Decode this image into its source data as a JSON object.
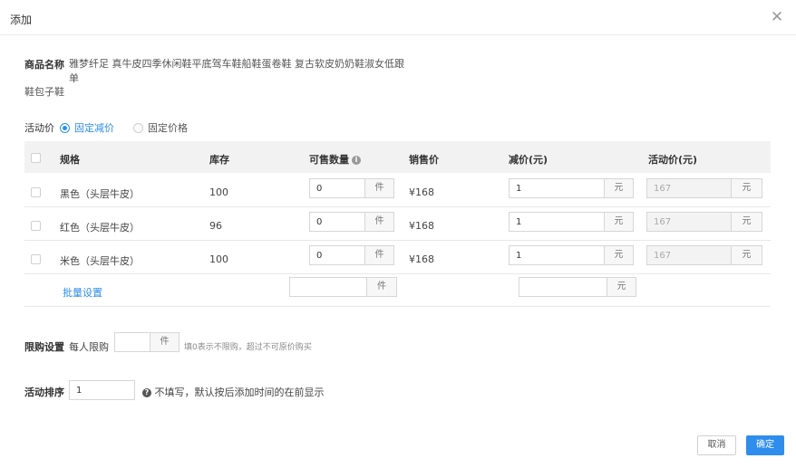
{
  "dialog": {
    "title": "添加",
    "close_glyph": "✕"
  },
  "product": {
    "label": "商品名称",
    "name_line1": "雅梦纤足 真牛皮四季休闲鞋平底驾车鞋船鞋蛋卷鞋 复古软皮奶奶鞋淑女低跟单",
    "name_line2": "鞋包子鞋"
  },
  "activity_price": {
    "label": "活动价",
    "options": [
      "固定减价",
      "固定价格"
    ],
    "selected": "固定减价"
  },
  "table": {
    "headers": {
      "spec": "规格",
      "stock": "库存",
      "sellable": "可售数量",
      "price": "销售价",
      "discount": "减价(元)",
      "activity": "活动价(元)"
    },
    "rows": [
      {
        "spec": "黑色（头层牛皮）",
        "stock": "100",
        "qty": "0",
        "qty_unit": "件",
        "price": "¥168",
        "discount": "1",
        "discount_unit": "元",
        "activity_price": "167",
        "activity_unit": "元"
      },
      {
        "spec": "红色（头层牛皮）",
        "stock": "96",
        "qty": "0",
        "qty_unit": "件",
        "price": "¥168",
        "discount": "1",
        "discount_unit": "元",
        "activity_price": "167",
        "activity_unit": "元"
      },
      {
        "spec": "米色（头层牛皮）",
        "stock": "100",
        "qty": "0",
        "qty_unit": "件",
        "price": "¥168",
        "discount": "1",
        "discount_unit": "元",
        "activity_price": "167",
        "activity_unit": "元"
      }
    ],
    "batch": {
      "link": "批量设置",
      "qty_value": "",
      "qty_unit": "件",
      "discount_value": "",
      "discount_unit": "元"
    }
  },
  "limit": {
    "label": "限购设置",
    "sub_label": "每人限购",
    "value": "",
    "unit": "件",
    "hint": "填0表示不限购，超过不可原价购买"
  },
  "sort": {
    "label": "活动排序",
    "value": "1",
    "hint": "不填写，默认按后添加时间的在前显示"
  },
  "buttons": {
    "cancel": "取消",
    "ok": "确定"
  },
  "colors": {
    "accent": "#2e8ded"
  }
}
